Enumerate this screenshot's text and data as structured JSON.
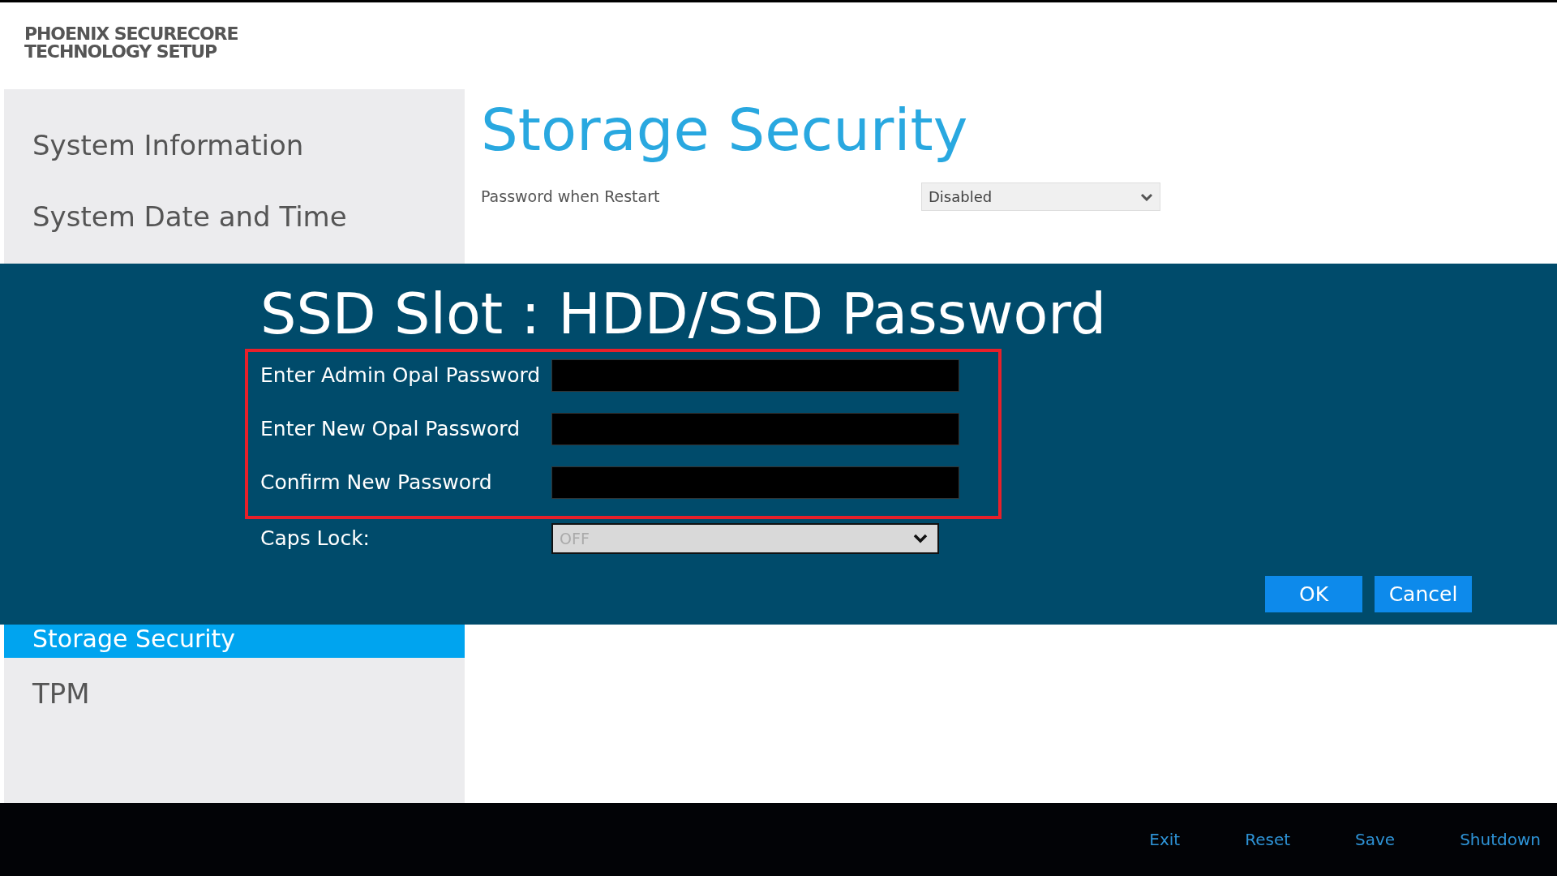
{
  "logo": {
    "lines": [
      "PHOENIX SECURECORE",
      "TECHNOLOGY SETUP"
    ]
  },
  "sidebar": {
    "groups": [
      {
        "items": [
          {
            "label": "System Information",
            "selected": false
          },
          {
            "label": "System Date and Time",
            "selected": false
          }
        ]
      },
      {
        "items": [
          {
            "label": "Storage Security",
            "selected": true
          },
          {
            "label": "TPM",
            "selected": false
          }
        ]
      }
    ]
  },
  "page": {
    "title": "Storage Security",
    "settings": [
      {
        "label": "Password when Restart",
        "value": "Disabled"
      }
    ]
  },
  "dialog": {
    "title": "SSD Slot : HDD/SSD Password",
    "password_fields_highlighted": true,
    "fields": [
      {
        "label": "Enter Admin Opal Password"
      },
      {
        "label": "Enter New Opal Password"
      },
      {
        "label": "Confirm New Password"
      }
    ],
    "caps_lock": {
      "label": "Caps Lock:",
      "value": "OFF",
      "disabled": true
    },
    "buttons": [
      "OK",
      "Cancel"
    ]
  },
  "footer": {
    "items": [
      "Exit",
      "Reset",
      "Save",
      "Shutdown"
    ]
  }
}
